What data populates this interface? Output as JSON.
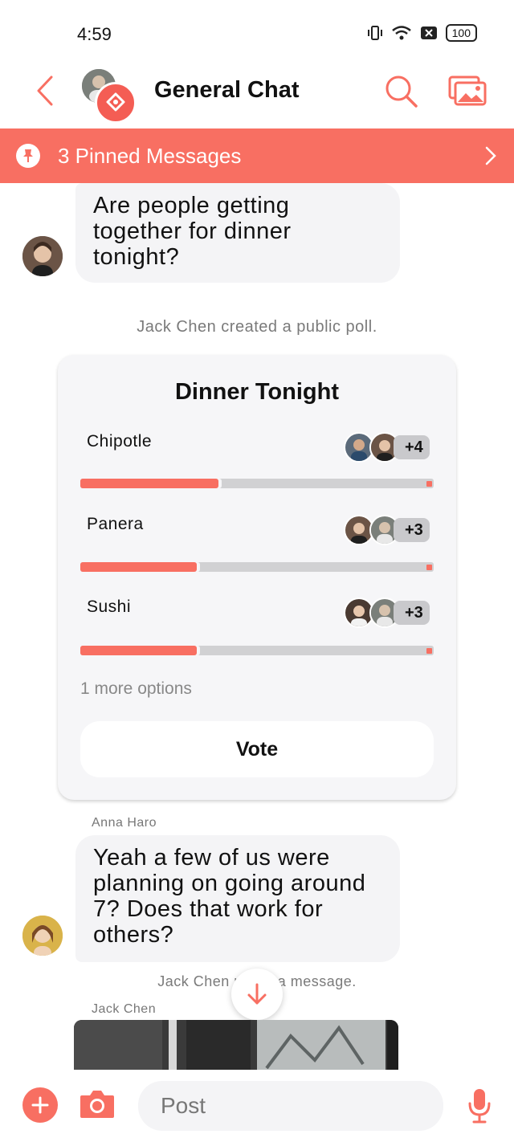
{
  "status_bar": {
    "time": "4:59",
    "battery": "100"
  },
  "header": {
    "title": "General Chat"
  },
  "pinned": {
    "label": "3 Pinned Messages"
  },
  "messages": {
    "first": {
      "text": "Are people getting together for dinner tonight?"
    },
    "system_poll": "Jack Chen created a public poll.",
    "second": {
      "sender": "Anna Haro",
      "text": "Yeah a few of us were planning on going around 7? Does that work for others?"
    },
    "system_partial": "Jack Chen p        a message.",
    "third": {
      "sender": "Jack Chen"
    }
  },
  "poll": {
    "title": "Dinner Tonight",
    "options": [
      {
        "label": "Chipotle",
        "extra_voters": "+4",
        "fraction": 0.39
      },
      {
        "label": "Panera",
        "extra_voters": "+3",
        "fraction": 0.33
      },
      {
        "label": "Sushi",
        "extra_voters": "+3",
        "fraction": 0.33
      }
    ],
    "more_options": "1 more options",
    "vote_label": "Vote"
  },
  "composer": {
    "placeholder": "Post"
  },
  "colors": {
    "accent": "#f86f62",
    "bubble": "#f4f4f6"
  }
}
